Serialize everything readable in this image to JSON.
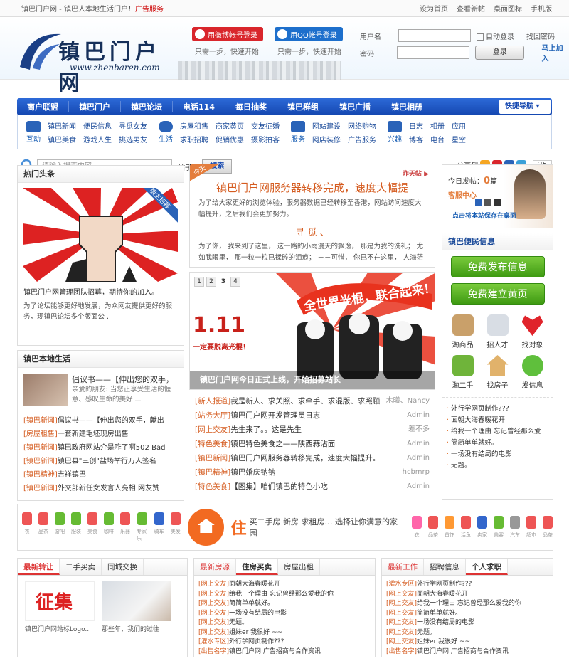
{
  "topbar": {
    "title": "镇巴门户网 - 镇巴人本地生活门户！",
    "ad": "广告服务",
    "links": [
      "设为首页",
      "查看新帖",
      "桌面图标",
      "手机版"
    ]
  },
  "logo": {
    "brand": "镇巴门户网",
    "url": "www.zhenbaren.com"
  },
  "oauth": {
    "weibo": "用微博帐号登录",
    "qq": "用QQ帐号登录",
    "tip": "只需一步，快速开始"
  },
  "login": {
    "user_label": "用户名",
    "pass_label": "密码",
    "auto": "自动登录",
    "button": "登录",
    "find": "找回密码",
    "register": "马上加入"
  },
  "nav": {
    "items": [
      "商户联盟",
      "镇巴门户",
      "镇巴论坛",
      "电话114",
      "每日抽奖",
      "镇巴群组",
      "镇巴广播",
      "镇巴相册"
    ],
    "quick": "快捷导航"
  },
  "subnav": [
    {
      "label": "互动",
      "links": [
        "镇巴新闻",
        "便民信息",
        "寻觅女友",
        "镇巴美食",
        "游戏人生",
        "挑选男友"
      ]
    },
    {
      "label": "生活",
      "links": [
        "房屋租售",
        "商家黄页",
        "交友征婚",
        "求职招聘",
        "促销优惠",
        "摄影拍客"
      ]
    },
    {
      "label": "服务",
      "links": [
        "网站建设",
        "网络购物",
        "网店装修",
        "广告服务"
      ]
    },
    {
      "label": "兴趣",
      "links": [
        "日志",
        "相册",
        "应用",
        "博客",
        "电台",
        "星空"
      ]
    }
  ],
  "search": {
    "placeholder": "请输入搜索内容",
    "type": "帖子",
    "button": "搜索",
    "share": "分享到",
    "count": "25"
  },
  "hot": {
    "title": "热门头条",
    "badge": "版主招募",
    "caption": "镇巴门户网管理团队招募，期待你的加入。",
    "desc": "为了论坛能够更好地发展，为众网友提供更好的服务，现镇巴论坛多个版面公 ..."
  },
  "local": {
    "title": "镇巴本地生活",
    "item_title": "倡议书——【伸出您的双手，",
    "item_desc": "亲爱的朋友: 当您正享受生活的惬意、感叹生命的美好 ...",
    "list": [
      [
        "[镇巴新闻]",
        "倡议书——【伸出您的双手，献出"
      ],
      [
        "[房屋租售]",
        "一套新建毛坯现房出售"
      ],
      [
        "[镇巴新闻]",
        "镇巴政府网站介是咋了啊502 Bad"
      ],
      [
        "[镇巴新闻]",
        "镇巴县\"三创\"盐场举行万人签名"
      ],
      [
        "[镇巴精神]",
        "吉祥镇巴"
      ],
      [
        "[镇巴新闻]",
        "外交部新任女发言人亮相 网友赞"
      ]
    ]
  },
  "feature": {
    "ribbon": "今天",
    "yest": "昨天帖",
    "title": "镇巴门户网服务器转移完成，速度大幅提",
    "text": "为了给大家更好的浏览体验，服务器数据已经转移至香港，网站访问速度大幅提升，之后我们会更加努力。",
    "sub": "寻 觅 、",
    "text2": "为了你， 我来到了这里， 这一路的小雨漫天的飘逸， 那是为我的洗礼； 尤如我眼里， 那一粒一粒已揉碎的泪痕； －－可惜， 你已不在这里， 人海茫"
  },
  "slider": {
    "pages": [
      "1",
      "2",
      "3",
      "4"
    ],
    "active": 2,
    "poster_title": "全世界光棍，联合起来！",
    "poster_date": "1.11",
    "poster_sub": "一定要脱离光棍！",
    "caption": "镇巴门户网今日正式上线，开始招募站长"
  },
  "news": [
    [
      "[新人报道]",
      "我是新人、求关照、求牵手、求混版、求照顾",
      "木曦、Nancy"
    ],
    [
      "[站务大厅]",
      "镇巴门户网开发管理员日志",
      "Admin"
    ],
    [
      "[网上交友]",
      "先生来了。。这是先生",
      "差不多"
    ],
    [
      "[特色美食]",
      "镇巴特色美食之——陕西蒜沾面",
      "Admin"
    ],
    [
      "[镇巴新闻]",
      "镇巴门户网服务器转移完成，速度大幅提升。",
      "Admin"
    ],
    [
      "[镇巴精神]",
      "镇巴婚庆钠钠",
      "hcbmrp"
    ],
    [
      "[特色美食]",
      "【图集】咱们镇巴的特色小吃",
      "Admin"
    ]
  ],
  "kefu": {
    "today": "今日发帖：",
    "count": "0",
    "unit": "篇",
    "center": "客服中心",
    "save": "点击将本站保存在桌面"
  },
  "bianmin": {
    "title": "镇巴便民信息",
    "btn1": "免费发布信息",
    "btn2": "免费建立黄页",
    "cells": [
      "淘商品",
      "招人才",
      "找对象",
      "淘二手",
      "找房子",
      "发信息"
    ],
    "list": [
      "外行学网页制作???",
      "面朝大海春暖花开",
      "给我一个理由 忘记曾经那么爱",
      "简简单单就好。",
      "一场没有结局的电影",
      "无题。"
    ]
  },
  "banner": {
    "minis": [
      "衣",
      "品茶",
      "游吧",
      "服装",
      "美食",
      "咖啡",
      "乐器",
      "专家乐",
      "骑车",
      "美发"
    ],
    "zhu": "住",
    "slogan": "买二手房  新房  求租房… 选择让你满意的家园",
    "minis2": [
      "衣",
      "品茶",
      "首饰",
      "活鱼",
      "卖家",
      "美容",
      "汽车",
      "超市",
      "品茶"
    ]
  },
  "bottom": {
    "t1": {
      "tabs": [
        "最新转让",
        "二手买卖",
        "同城交换"
      ],
      "pics": [
        {
          "label": "征集",
          "cap": "镇巴门户网站标Logo..."
        },
        {
          "label": "",
          "cap": "那些年，我们的过往"
        }
      ]
    },
    "t2": {
      "tabs": [
        "最新房源",
        "住房买卖",
        "房屋出租"
      ],
      "list": [
        [
          "[网上交友]",
          "面朝大海春暖花开"
        ],
        [
          "[网上交友]",
          "给我一个理由 忘记曾经那么爱我的你"
        ],
        [
          "[网上交友]",
          "简简单单就好。"
        ],
        [
          "[网上交友]",
          "一场没有结局的电影"
        ],
        [
          "[网上交友]",
          "无题。"
        ],
        [
          "[网上交友]",
          "姐妹er 我很好 ~~"
        ],
        [
          "[灌水专区]",
          "外行学网页制作???"
        ],
        [
          "[出售名字]",
          "镇巴门户网  广告招商与合作资讯"
        ]
      ]
    },
    "t3": {
      "tabs": [
        "最新工作",
        "招聘信息",
        "个人求职"
      ],
      "list": [
        [
          "[灌水专区]",
          "外行学网页制作???"
        ],
        [
          "[网上交友]",
          "面朝大海春暖花开"
        ],
        [
          "[网上交友]",
          "给我一个理由 忘记曾经那么爱我的你"
        ],
        [
          "[网上交友]",
          "简简单单就好。"
        ],
        [
          "[网上交友]",
          "一场没有结局的电影"
        ],
        [
          "[网上交友]",
          "无题。"
        ],
        [
          "[网上交友]",
          "姐妹er 我很好 ~~"
        ],
        [
          "[出售名字]",
          "镇巴门户网  广告招商与合作资讯"
        ]
      ]
    }
  },
  "colors": {
    "nav": "#1447b0",
    "accent": "#d55c20",
    "green": "#4aa81c",
    "red": "#d33"
  }
}
